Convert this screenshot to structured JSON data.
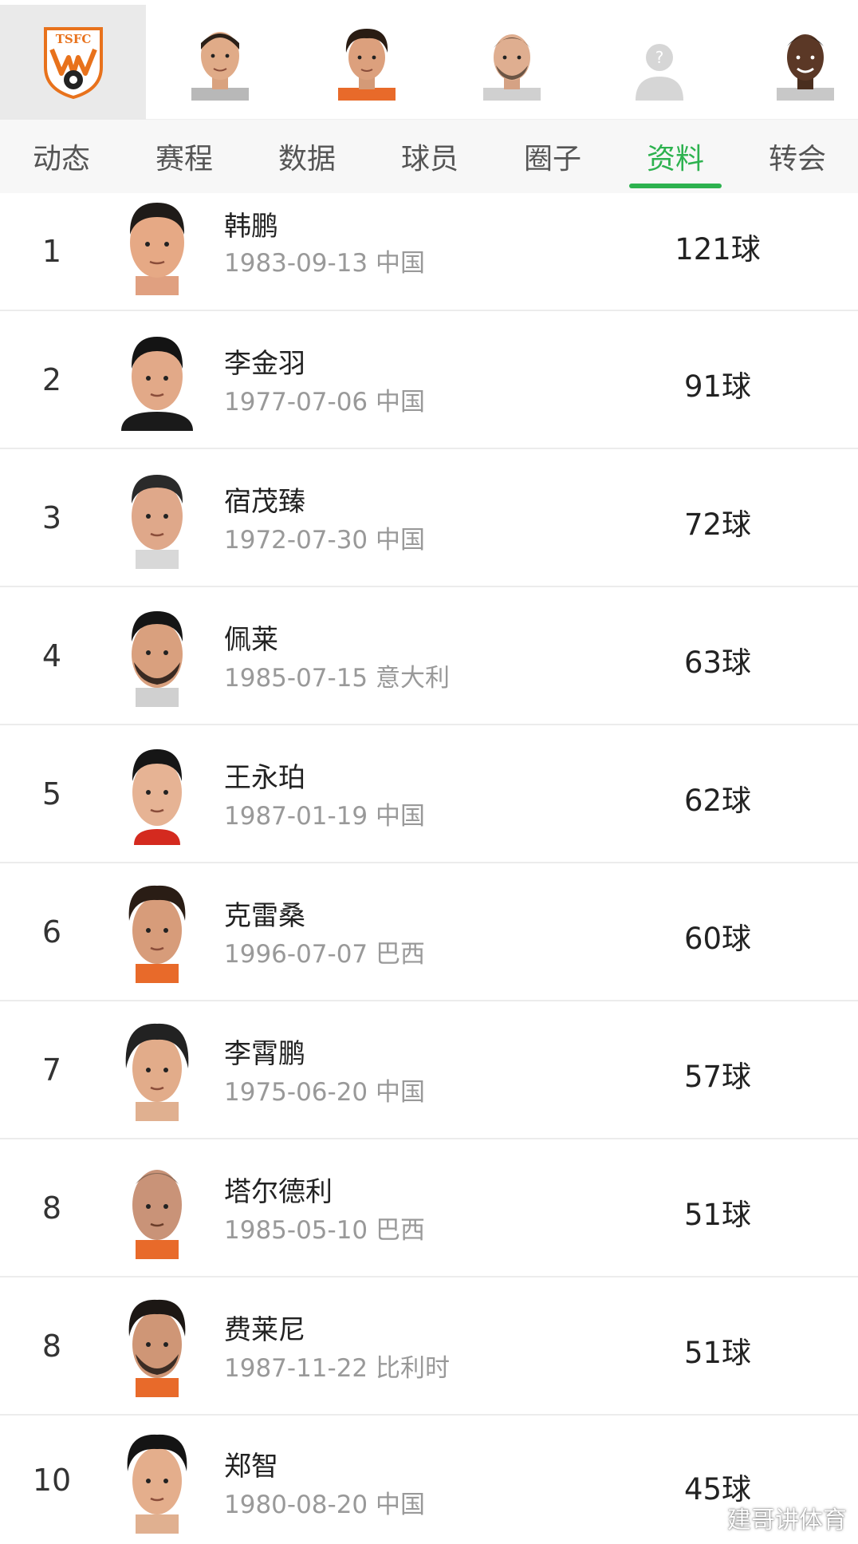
{
  "header": {
    "club_logo_text": "TSFC",
    "thumbnails": [
      {
        "icon": "player-photo"
      },
      {
        "icon": "player-photo"
      },
      {
        "icon": "player-photo"
      },
      {
        "icon": "default-avatar-icon"
      },
      {
        "icon": "player-photo"
      }
    ]
  },
  "tabs": [
    {
      "label": "动态",
      "active": false
    },
    {
      "label": "赛程",
      "active": false
    },
    {
      "label": "数据",
      "active": false
    },
    {
      "label": "球员",
      "active": false
    },
    {
      "label": "圈子",
      "active": false
    },
    {
      "label": "资料",
      "active": true
    },
    {
      "label": "转会",
      "active": false
    }
  ],
  "scorers": [
    {
      "rank": "1",
      "name": "韩鹏",
      "meta": "1983-09-13 中国",
      "goals": "121球"
    },
    {
      "rank": "2",
      "name": "李金羽",
      "meta": "1977-07-06 中国",
      "goals": "91球"
    },
    {
      "rank": "3",
      "name": "宿茂臻",
      "meta": "1972-07-30 中国",
      "goals": "72球"
    },
    {
      "rank": "4",
      "name": "佩莱",
      "meta": "1985-07-15 意大利",
      "goals": "63球"
    },
    {
      "rank": "5",
      "name": "王永珀",
      "meta": "1987-01-19 中国",
      "goals": "62球"
    },
    {
      "rank": "6",
      "name": "克雷桑",
      "meta": "1996-07-07 巴西",
      "goals": "60球"
    },
    {
      "rank": "7",
      "name": "李霄鹏",
      "meta": "1975-06-20 中国",
      "goals": "57球"
    },
    {
      "rank": "8",
      "name": "塔尔德利",
      "meta": "1985-05-10 巴西",
      "goals": "51球"
    },
    {
      "rank": "8",
      "name": "费莱尼",
      "meta": "1987-11-22 比利时",
      "goals": "51球"
    },
    {
      "rank": "10",
      "name": "郑智",
      "meta": "1980-08-20 中国",
      "goals": "45球"
    }
  ],
  "watermark": "建哥讲体育",
  "colors": {
    "accent": "#2db24f",
    "logo_orange": "#e8721c",
    "divider": "#ececec",
    "meta_text": "#999999"
  }
}
